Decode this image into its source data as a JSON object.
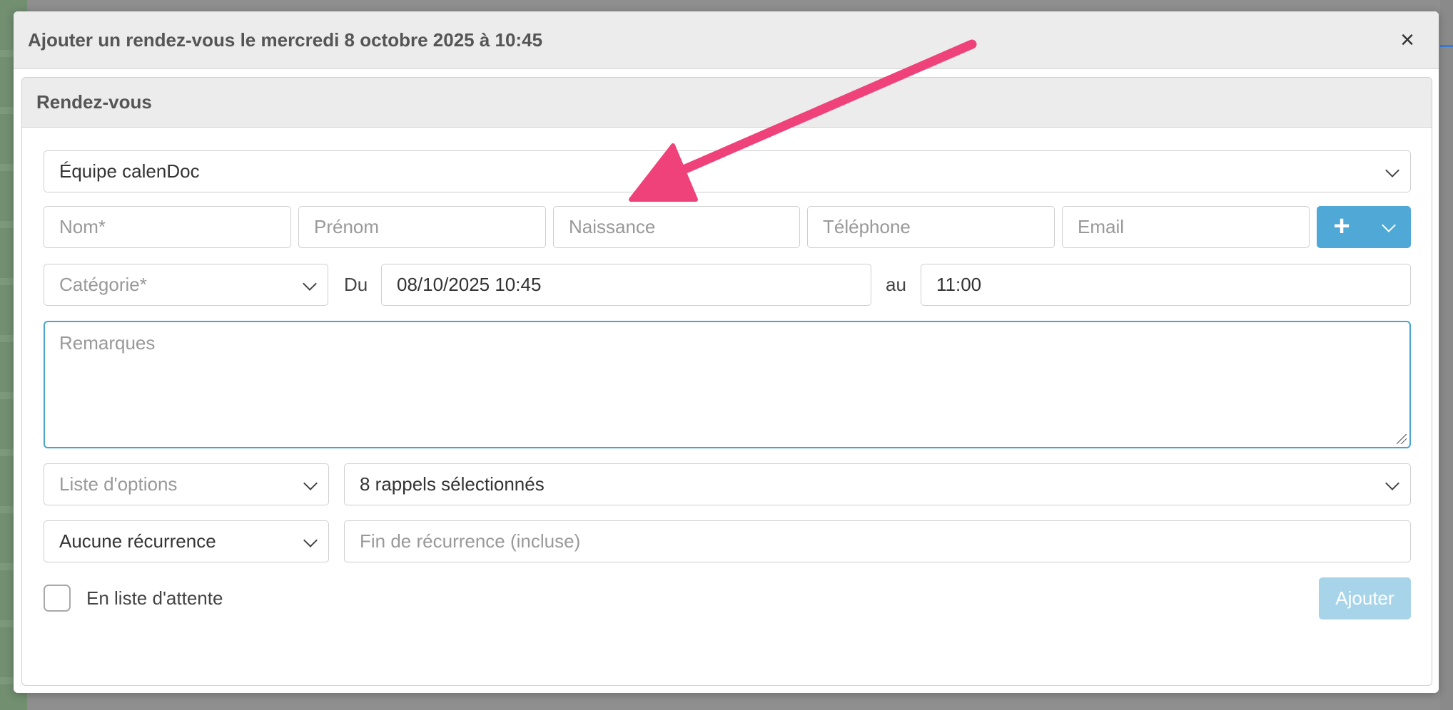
{
  "modal": {
    "title": "Ajouter un rendez-vous le mercredi 8 octobre 2025 à 10:45",
    "close_glyph": "×"
  },
  "panel": {
    "title": "Rendez-vous"
  },
  "form": {
    "team_select_value": "Équipe calenDoc",
    "patient": {
      "nom_placeholder": "Nom*",
      "prenom_placeholder": "Prénom",
      "naissance_placeholder": "Naissance",
      "telephone_placeholder": "Téléphone",
      "email_placeholder": "Email",
      "add_glyph": "+"
    },
    "categorie_placeholder": "Catégorie*",
    "du_label": "Du",
    "start_value": "08/10/2025 10:45",
    "au_label": "au",
    "end_value": "11:00",
    "remarques_placeholder": "Remarques",
    "options_placeholder": "Liste d'options",
    "rappels_value": "8 rappels sélectionnés",
    "recurrence_value": "Aucune récurrence",
    "fin_recurrence_placeholder": "Fin de récurrence (incluse)",
    "waitlist_label": "En liste d'attente",
    "waitlist_checked": false,
    "submit_label": "Ajouter"
  },
  "colors": {
    "primary": "#4fa8d6",
    "primary_disabled": "#a8d4ea",
    "focus_border": "#4aa3c9",
    "annotation_arrow": "#f0427a"
  },
  "annotation": {
    "arrow_icon": "pink-arrow-icon"
  }
}
